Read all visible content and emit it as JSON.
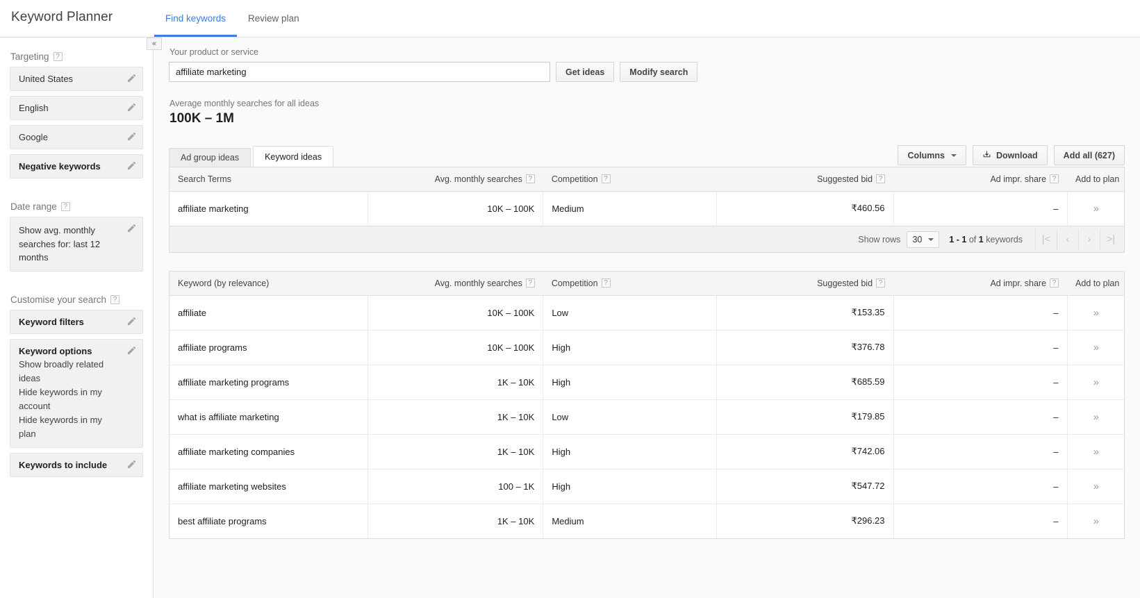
{
  "app": {
    "title": "Keyword Planner",
    "collapse_icon": "chevron-double-left-icon"
  },
  "top_tabs": [
    {
      "label": "Find keywords",
      "active": true
    },
    {
      "label": "Review plan",
      "active": false
    }
  ],
  "sidebar": {
    "sections": [
      {
        "heading": "Targeting",
        "help": "?",
        "items": [
          {
            "label": "United States",
            "bold": false
          },
          {
            "label": "English",
            "bold": false
          },
          {
            "label": "Google",
            "bold": false
          },
          {
            "label": "Negative keywords",
            "bold": true
          }
        ]
      },
      {
        "heading": "Date range",
        "help": "?",
        "items": [
          {
            "label": "Show avg. monthly searches for: last 12 months",
            "bold": false
          }
        ]
      },
      {
        "heading": "Customise your search",
        "help": "?",
        "items": [
          {
            "label": "Keyword filters",
            "bold": true
          },
          {
            "label": "Keyword options",
            "bold": true,
            "sublines": [
              "Show broadly related ideas",
              "Hide keywords in my account",
              "Hide keywords in my plan"
            ]
          },
          {
            "label": "Keywords to include",
            "bold": true
          }
        ]
      }
    ]
  },
  "search": {
    "field_label": "Your product or service",
    "value": "affiliate marketing",
    "placeholder": "Your product or service",
    "get_ideas_label": "Get ideas",
    "modify_search_label": "Modify search"
  },
  "stats": {
    "label": "Average monthly searches for all ideas",
    "value": "100K – 1M"
  },
  "sheet_tabs": [
    {
      "label": "Ad group ideas",
      "active": false
    },
    {
      "label": "Keyword ideas",
      "active": true
    }
  ],
  "toolbar": {
    "columns_label": "Columns",
    "download_label": "Download",
    "download_icon": "download-icon",
    "add_all_label": "Add all (627)"
  },
  "search_terms_table": {
    "headers": {
      "keyword": "Search Terms",
      "avg": "Avg. monthly searches",
      "competition": "Competition",
      "bid": "Suggested bid",
      "share": "Ad impr. share",
      "add": "Add to plan"
    },
    "rows": [
      {
        "keyword": "affiliate marketing",
        "avg": "10K – 100K",
        "competition": "Medium",
        "bid": "₹460.56",
        "share": "–",
        "add": "»"
      }
    ]
  },
  "pager": {
    "show_rows_label": "Show rows",
    "rows_value": "30",
    "range_prefix": "1 - 1",
    "range_middle": "of",
    "range_count": "1",
    "range_suffix": "keywords",
    "first_icon": "|<",
    "prev_icon": "‹",
    "next_icon": "›",
    "last_icon": ">|"
  },
  "keyword_ideas_table": {
    "headers": {
      "keyword": "Keyword (by relevance)",
      "avg": "Avg. monthly searches",
      "competition": "Competition",
      "bid": "Suggested bid",
      "share": "Ad impr. share",
      "add": "Add to plan"
    },
    "rows": [
      {
        "keyword": "affiliate",
        "avg": "10K – 100K",
        "competition": "Low",
        "bid": "₹153.35",
        "share": "–",
        "add": "»"
      },
      {
        "keyword": "affiliate programs",
        "avg": "10K – 100K",
        "competition": "High",
        "bid": "₹376.78",
        "share": "–",
        "add": "»"
      },
      {
        "keyword": "affiliate marketing programs",
        "avg": "1K – 10K",
        "competition": "High",
        "bid": "₹685.59",
        "share": "–",
        "add": "»"
      },
      {
        "keyword": "what is affiliate marketing",
        "avg": "1K – 10K",
        "competition": "Low",
        "bid": "₹179.85",
        "share": "–",
        "add": "»"
      },
      {
        "keyword": "affiliate marketing companies",
        "avg": "1K – 10K",
        "competition": "High",
        "bid": "₹742.06",
        "share": "–",
        "add": "»"
      },
      {
        "keyword": "affiliate marketing websites",
        "avg": "100 – 1K",
        "competition": "High",
        "bid": "₹547.72",
        "share": "–",
        "add": "»"
      },
      {
        "keyword": "best affiliate programs",
        "avg": "1K – 10K",
        "competition": "Medium",
        "bid": "₹296.23",
        "share": "–",
        "add": "»"
      }
    ]
  },
  "colors": {
    "accent": "#3c7ddf",
    "text": "#212121",
    "muted": "#757575",
    "panel_bg": "#f1f1f1",
    "page_bg": "#fafafa"
  }
}
